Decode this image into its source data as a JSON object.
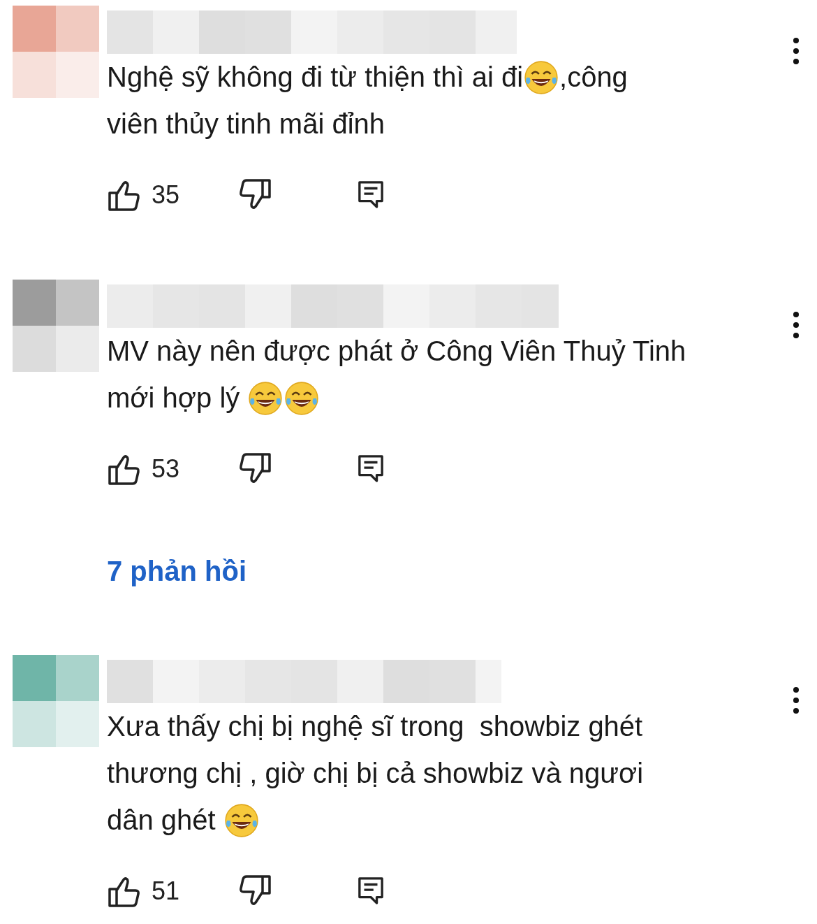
{
  "comments": [
    {
      "color": "#e8a696",
      "lines": [
        [
          {
            "kind": "text",
            "text": "Nghệ sỹ không đi từ thiện thì ai đi"
          },
          {
            "kind": "emoji"
          },
          {
            "kind": "text",
            "text": ",công"
          }
        ],
        [
          {
            "kind": "text",
            "text": "viên thủy tinh mãi đỉnh"
          }
        ]
      ],
      "likes": "35"
    },
    {
      "color": "#9c9c9c",
      "lines": [
        [
          {
            "kind": "text",
            "text": "MV này nên được phát ở Công Viên Thuỷ Tinh"
          }
        ],
        [
          {
            "kind": "text",
            "text": "mới hợp lý "
          },
          {
            "kind": "emoji"
          },
          {
            "kind": "emoji"
          }
        ]
      ],
      "likes": "53",
      "replies": "7 phản hồi"
    },
    {
      "color": "#6fb5a8",
      "lines": [
        [
          {
            "kind": "text",
            "text": "Xưa thấy chị bị nghệ sĩ trong  showbiz ghét"
          }
        ],
        [
          {
            "kind": "text",
            "text": "thương chị , giờ chị bị cả showbiz và ngươi"
          }
        ],
        [
          {
            "kind": "text",
            "text": "dân ghét "
          },
          {
            "kind": "emoji"
          }
        ]
      ],
      "likes": "51"
    }
  ]
}
